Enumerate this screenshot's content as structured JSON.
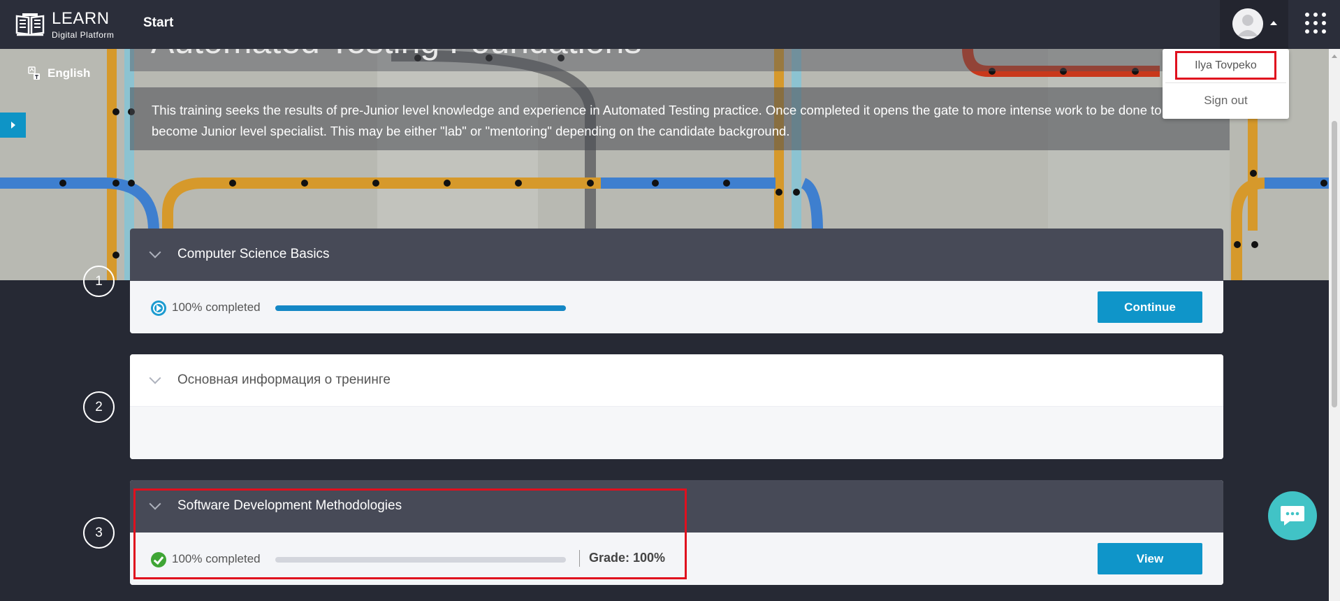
{
  "brand": {
    "title": "LEARN",
    "subtitle": "Digital Platform",
    "logo_icon": "open-book-icon"
  },
  "nav": {
    "start": "Start"
  },
  "user_menu": {
    "name": "Ilya Tovpeko",
    "sign_out": "Sign out",
    "avatar_icon": "user-avatar-icon",
    "apps_icon": "apps-grid-icon"
  },
  "language": {
    "label": "English",
    "icon": "translate-icon"
  },
  "course": {
    "title": "Automated Testing Foundations",
    "description_line1": "This training seeks the results of pre-Junior level knowledge and experience in Automated Testing practice. Once completed it opens the gate to more intense work to be done to",
    "description_line2": "become Junior level specialist. This may be either \"lab\" or \"mentoring\" depending on the candidate background."
  },
  "modules": [
    {
      "number": "1",
      "title": "Computer Science Basics",
      "status": "100% completed",
      "progress": 1.0,
      "button": "Continue",
      "status_icon": "play-icon"
    },
    {
      "number": "2",
      "title": "Основная информация о тренинге"
    },
    {
      "number": "3",
      "title": "Software Development Methodologies",
      "status": "100% completed",
      "progress": 0,
      "grade": "Grade: 100%",
      "button": "View",
      "status_icon": "check-icon"
    }
  ],
  "colors": {
    "accent": "#0f95c9",
    "topbar": "#2b2e3a",
    "highlight": "#e0101e",
    "chat": "#41c3c6",
    "success": "#3fa535"
  },
  "chat": {
    "icon": "chat-bubble-icon"
  }
}
